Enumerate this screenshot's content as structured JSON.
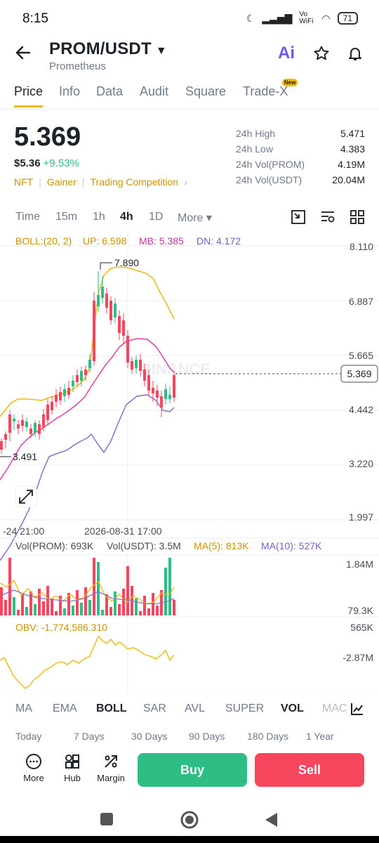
{
  "status": {
    "time": "8:15",
    "network": "Vo WiFi",
    "battery": "71"
  },
  "header": {
    "pair": "PROM/USDT",
    "name": "Prometheus",
    "ai_label": "Ai"
  },
  "tabs": [
    {
      "label": "Price"
    },
    {
      "label": "Info"
    },
    {
      "label": "Data"
    },
    {
      "label": "Audit"
    },
    {
      "label": "Square"
    },
    {
      "label": "Trade-X"
    }
  ],
  "new_badge": "New",
  "price": {
    "last": "5.369",
    "usd": "$5.36",
    "change": "+9.53%"
  },
  "tags": [
    "NFT",
    "Gainer",
    "Trading Competition"
  ],
  "stats": [
    {
      "k": "24h High",
      "v": "5.471"
    },
    {
      "k": "24h Low",
      "v": "4.383"
    },
    {
      "k": "24h Vol(PROM)",
      "v": "4.19M"
    },
    {
      "k": "24h Vol(USDT)",
      "v": "20.04M"
    }
  ],
  "timeframes": [
    "Time",
    "15m",
    "1h",
    "4h",
    "1D",
    "More ▾"
  ],
  "chart": {
    "boll_label": "BOLL:(20, 2)",
    "up_label": "UP: 6.598",
    "mb_label": "MB: 5.385",
    "dn_label": "DN: 4.172",
    "y_ticks": [
      "8.110",
      "6.887",
      "5.665",
      "4.442",
      "3.220",
      "1.997"
    ],
    "current_price": "5.369",
    "high_marker": "7.890",
    "low_marker": "3.491",
    "x_labels": [
      "-24 21:00",
      "2026-08-31 17:00"
    ],
    "watermark": "BINANCE",
    "vol_label": "Vol(PROM): 693K",
    "vol_usdt_label": "Vol(USDT): 3.5M",
    "ma5_label": "MA(5): 813K",
    "ma10_label": "MA(10): 527K",
    "vol_ticks": [
      "1.84M",
      "79.3K"
    ],
    "obv_label": "OBV: -1,774,586.310",
    "obv_ticks": [
      "565K",
      "-2.87M"
    ],
    "colors": {
      "up": "#2ebd85",
      "down": "#f6465d",
      "boll_up": "#f0b90b",
      "boll_mb": "#e040a0",
      "boll_dn": "#8a6fc8",
      "ma10": "#8a6fc8"
    }
  },
  "chart_data": {
    "type": "candlestick",
    "y_range": [
      1.997,
      8.11
    ],
    "high": 7.89,
    "low": 3.491,
    "last": 5.369,
    "boll": {
      "up": 6.598,
      "mb": 5.385,
      "dn": 4.172
    }
  },
  "indicators": [
    "MA",
    "EMA",
    "BOLL",
    "SAR",
    "AVL",
    "SUPER",
    "VOL",
    "MAC"
  ],
  "periods": [
    "Today",
    "7 Days",
    "30 Days",
    "90 Days",
    "180 Days",
    "1 Year"
  ],
  "actions": [
    {
      "label": "More",
      "icon": "more-icon"
    },
    {
      "label": "Hub",
      "icon": "hub-icon"
    },
    {
      "label": "Margin",
      "icon": "margin-icon"
    }
  ],
  "buy_label": "Buy",
  "sell_label": "Sell"
}
